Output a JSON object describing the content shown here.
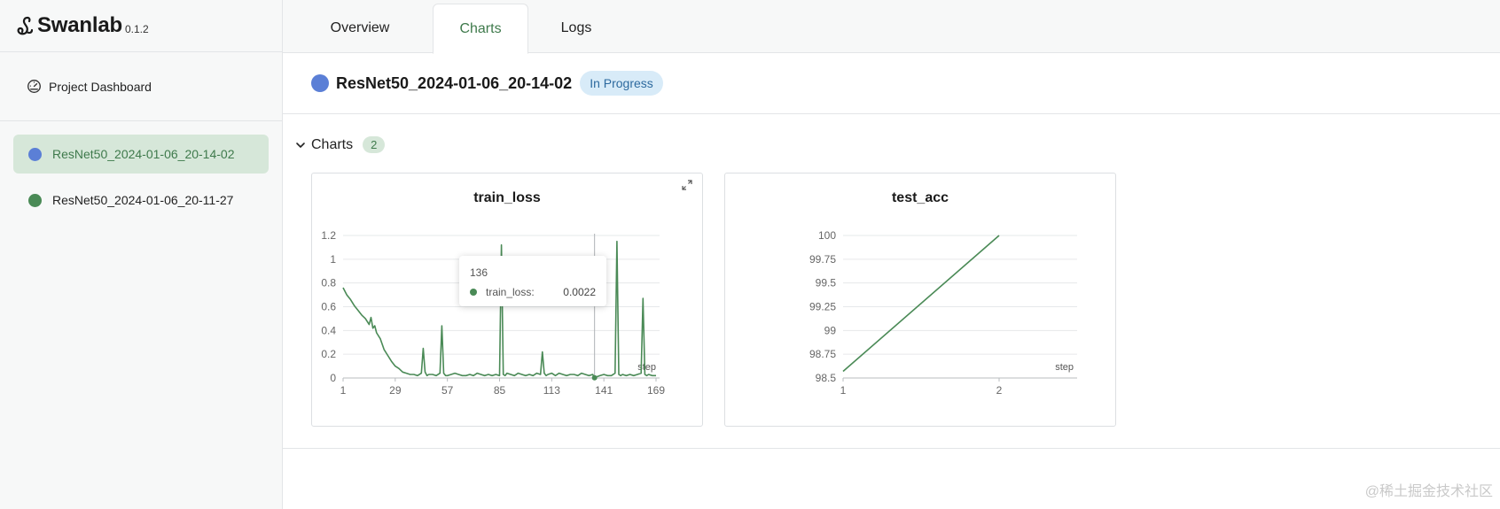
{
  "brand": {
    "name": "Swanlab",
    "version": "0.1.2"
  },
  "sidebar": {
    "dashboard_label": "Project Dashboard",
    "experiments": [
      {
        "name": "ResNet50_2024-01-06_20-14-02",
        "color": "#5b7fd6",
        "active": true
      },
      {
        "name": "ResNet50_2024-01-06_20-11-27",
        "color": "#4a8a56",
        "active": false
      }
    ]
  },
  "tabs": [
    {
      "label": "Overview",
      "active": false
    },
    {
      "label": "Charts",
      "active": true
    },
    {
      "label": "Logs",
      "active": false
    }
  ],
  "run": {
    "title": "ResNet50_2024-01-06_20-14-02",
    "status": "In Progress",
    "color": "#5b7fd6"
  },
  "section": {
    "title": "Charts",
    "count": "2"
  },
  "tooltip": {
    "step": "136",
    "label": "train_loss:",
    "value": "0.0022"
  },
  "watermark": "@稀土掘金技术社区",
  "colors": {
    "accent": "#3f7a4c",
    "series": "#4a8a56"
  },
  "chart_data": [
    {
      "type": "line",
      "title": "train_loss",
      "xlabel": "step",
      "ylabel": "",
      "xlim": [
        1,
        169
      ],
      "ylim": [
        0,
        1.2
      ],
      "xticks": [
        1,
        29,
        57,
        85,
        113,
        141,
        169
      ],
      "yticks": [
        0,
        0.2,
        0.4,
        0.6,
        0.8,
        1,
        1.2
      ],
      "hover_step": 136,
      "series": [
        {
          "x": [
            1,
            3,
            5,
            7,
            9,
            11,
            13,
            15,
            16,
            17,
            18,
            19,
            21,
            23,
            25,
            27,
            29,
            31,
            33,
            35,
            37,
            39,
            41,
            43,
            44,
            45,
            46,
            47,
            49,
            51,
            53,
            54,
            55,
            56,
            57,
            59,
            61,
            63,
            65,
            67,
            69,
            71,
            73,
            75,
            77,
            79,
            81,
            83,
            85,
            86,
            87,
            88,
            89,
            91,
            93,
            95,
            97,
            99,
            101,
            103,
            105,
            107,
            108,
            109,
            110,
            111,
            113,
            115,
            117,
            119,
            121,
            123,
            125,
            127,
            129,
            131,
            133,
            135,
            136,
            137,
            139,
            141,
            143,
            145,
            147,
            148,
            149,
            150,
            151,
            153,
            155,
            157,
            159,
            161,
            162,
            163,
            164,
            165,
            167,
            169
          ],
          "y": [
            0.76,
            0.7,
            0.66,
            0.61,
            0.57,
            0.53,
            0.5,
            0.45,
            0.51,
            0.42,
            0.44,
            0.38,
            0.33,
            0.24,
            0.19,
            0.14,
            0.1,
            0.08,
            0.05,
            0.04,
            0.03,
            0.03,
            0.02,
            0.04,
            0.25,
            0.05,
            0.02,
            0.03,
            0.03,
            0.02,
            0.04,
            0.44,
            0.04,
            0.02,
            0.02,
            0.03,
            0.04,
            0.03,
            0.02,
            0.02,
            0.03,
            0.02,
            0.04,
            0.03,
            0.02,
            0.03,
            0.02,
            0.03,
            0.02,
            1.12,
            0.03,
            0.02,
            0.04,
            0.03,
            0.02,
            0.04,
            0.03,
            0.02,
            0.03,
            0.02,
            0.04,
            0.03,
            0.22,
            0.04,
            0.02,
            0.03,
            0.04,
            0.02,
            0.04,
            0.03,
            0.02,
            0.03,
            0.03,
            0.02,
            0.04,
            0.03,
            0.02,
            0.03,
            0.002,
            0.01,
            0.02,
            0.03,
            0.02,
            0.02,
            0.04,
            1.15,
            0.03,
            0.02,
            0.03,
            0.02,
            0.03,
            0.02,
            0.03,
            0.04,
            0.67,
            0.03,
            0.02,
            0.03,
            0.02,
            0.02
          ]
        }
      ]
    },
    {
      "type": "line",
      "title": "test_acc",
      "xlabel": "step",
      "ylabel": "",
      "xlim": [
        1,
        2
      ],
      "ylim": [
        98.5,
        100
      ],
      "xticks": [
        1,
        2
      ],
      "yticks": [
        98.5,
        98.75,
        99,
        99.25,
        99.5,
        99.75,
        100
      ],
      "series": [
        {
          "x": [
            1,
            2
          ],
          "y": [
            98.57,
            100
          ]
        }
      ]
    }
  ]
}
